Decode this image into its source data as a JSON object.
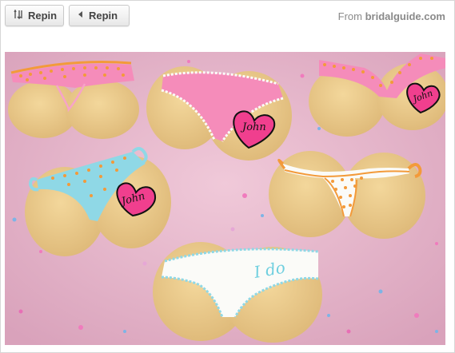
{
  "toolbar": {
    "repin_primary_label": "Repin",
    "repin_primary_icon": "repin-icon",
    "repin_secondary_label": "Repin",
    "repin_secondary_icon": "caret-left-icon"
  },
  "source": {
    "prefix": "From",
    "domain": "bridalguide.com"
  },
  "image": {
    "cookie_texts": [
      "John",
      "John",
      "John",
      "I do"
    ],
    "colors": {
      "background": "#e7b9cd",
      "cookie": "#e9c98a",
      "pink_icing": "#f58cba",
      "orange_icing": "#f39a3a",
      "blue_icing": "#8fd8e6",
      "white_icing": "#fbfbf8",
      "heart": "#f03f8e"
    }
  }
}
